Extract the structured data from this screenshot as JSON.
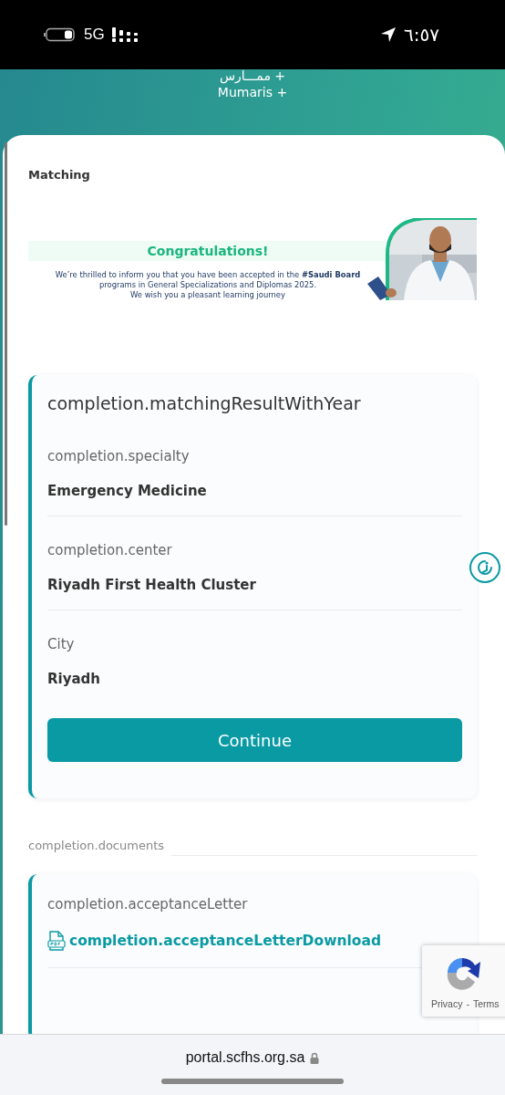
{
  "status_bar": {
    "network": "5G",
    "time": "٦:٥٧"
  },
  "header": {
    "logo_arabic": "ممـــارس +",
    "logo_latin": "Mumaris +"
  },
  "page_title": "Matching",
  "banner": {
    "kind": "picture",
    "heading": "Congratulations!",
    "message": "We’re thrilled to inform you that you have been accepted in the **#Saudi Board** programs in General Specializations and Diplomas 2025.",
    "closing": "We wish you a pleasant learning journey"
  },
  "result_card": {
    "title": "completion.matchingResultWithYear",
    "fields": [
      {
        "label": "completion.specialty",
        "value": "Emergency Medicine"
      },
      {
        "label": "completion.center",
        "value": "Riyadh First Health Cluster"
      },
      {
        "label": "City",
        "value": "Riyadh"
      }
    ],
    "button": "Continue"
  },
  "documents": {
    "heading": "completion.documents",
    "items": [
      {
        "label": "completion.acceptanceLetter",
        "link": "completion.acceptanceLetterDownload"
      }
    ]
  },
  "recaptcha": {
    "links": [
      "Privacy",
      "Terms"
    ],
    "separator": "-"
  },
  "browser_bar": {
    "url": "portal.scfhs.org.sa"
  }
}
